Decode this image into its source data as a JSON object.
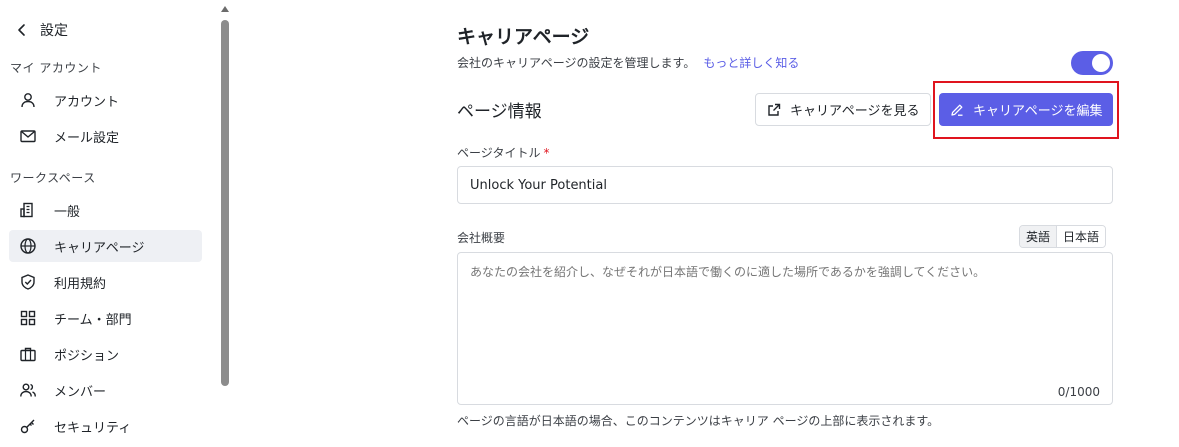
{
  "sidebar": {
    "title": "設定",
    "sections": [
      {
        "label": "マイ アカウント",
        "items": [
          {
            "label": "アカウント",
            "icon": "user-icon"
          },
          {
            "label": "メール設定",
            "icon": "mail-icon"
          }
        ]
      },
      {
        "label": "ワークスペース",
        "items": [
          {
            "label": "一般",
            "icon": "building-icon"
          },
          {
            "label": "キャリアページ",
            "icon": "globe-icon",
            "active": true
          },
          {
            "label": "利用規約",
            "icon": "shield-icon"
          },
          {
            "label": "チーム・部門",
            "icon": "grid-icon"
          },
          {
            "label": "ポジション",
            "icon": "briefcase-icon"
          },
          {
            "label": "メンバー",
            "icon": "users-icon"
          },
          {
            "label": "セキュリティ",
            "icon": "key-icon"
          }
        ]
      }
    ]
  },
  "main": {
    "title": "キャリアページ",
    "description": "会社のキャリアページの設定を管理します。",
    "learn_more": "もっと詳しく知る",
    "toggle_on": true,
    "section_title": "ページ情報",
    "view_button": "キャリアページを見る",
    "edit_button": "キャリアページを編集",
    "page_title_label": "ページタイトル",
    "required_mark": "*",
    "page_title_value": "Unlock Your Potential",
    "company_overview_label": "会社概要",
    "lang_en": "英語",
    "lang_ja": "日本語",
    "overview_placeholder": "あなたの会社を紹介し、なぜそれが日本語で働くのに適した場所であるかを強調してください。",
    "counter": "0/1000",
    "help_text": "ページの言語が日本語の場合、このコンテンツはキャリア ページの上部に表示されます。"
  },
  "colors": {
    "accent": "#5b5ee6",
    "highlight": "#e0141e",
    "active_bg": "#eef0f4"
  }
}
